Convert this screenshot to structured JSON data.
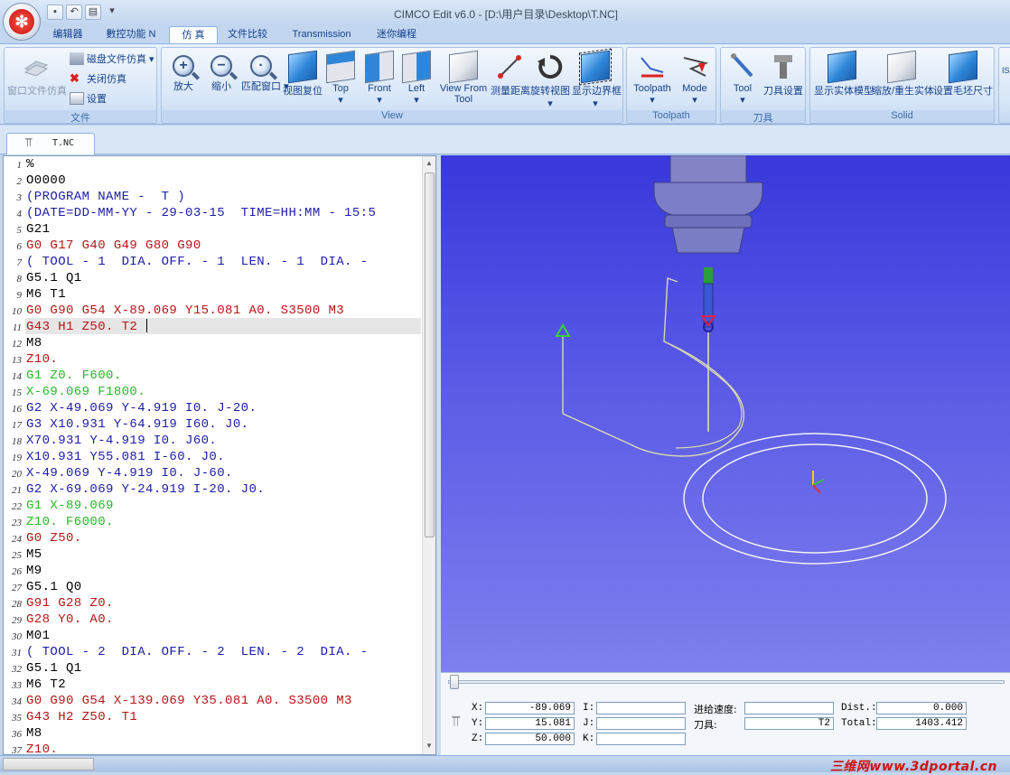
{
  "window": {
    "title": "CIMCO Edit v6.0 - [D:\\用户目录\\Desktop\\T.NC]"
  },
  "tabs": [
    "编辑器",
    "數控功能 N",
    "仿 真",
    "文件比较",
    "Transmission",
    "迷你编程"
  ],
  "active_tab": "仿 真",
  "ribbon": {
    "file_group": {
      "caption": "文件",
      "open_window": "窗口文件仿真",
      "disk_sim": "磁盘文件仿真",
      "close_sim": "关闭仿真",
      "settings": "设置"
    },
    "view_group": {
      "caption": "View",
      "buttons": [
        "放大",
        "缩小",
        "匹配窗口",
        "视图复位",
        "Top",
        "Front",
        "Left",
        "View From Tool",
        "测量距离",
        "旋转视图",
        "显示边界框"
      ]
    },
    "toolpath_group": {
      "caption": "Toolpath",
      "buttons": [
        "Toolpath",
        "Mode"
      ]
    },
    "tool_group": {
      "caption": "刀具",
      "buttons": [
        "Tool",
        "刀具设置"
      ]
    },
    "solid_group": {
      "caption": "Solid",
      "buttons": [
        "显示实体模型",
        "缩放/重生实体",
        "设置毛坯尺寸"
      ]
    },
    "extra_label": "IS"
  },
  "document_tab": "T.NC",
  "code_lines": [
    {
      "n": "1",
      "t": "%",
      "c": "#000000"
    },
    {
      "n": "2",
      "t": "O0000",
      "c": "#000000"
    },
    {
      "n": "3",
      "t": "(PROGRAM NAME -  T )",
      "c": "#1c1ca8"
    },
    {
      "n": "4",
      "t": "(DATE=DD-MM-YY - 29-03-15  TIME=HH:MM - 15:5",
      "c": "#1c1ca8"
    },
    {
      "n": "5",
      "t": "G21",
      "c": "#000000"
    },
    {
      "n": "6",
      "t": "G0 G17 G40 G49 G80 G90",
      "c": "#b81414"
    },
    {
      "n": "7",
      "t": "( TOOL - 1  DIA. OFF. - 1  LEN. - 1  DIA. -",
      "c": "#1c1ca8"
    },
    {
      "n": "8",
      "t": "G5.1 Q1",
      "c": "#000000"
    },
    {
      "n": "9",
      "t": "M6 T1",
      "c": "#000000"
    },
    {
      "n": "10",
      "t": "G0 G90 G54 X-89.069 Y15.081 A0. S3500 M3",
      "c": "#b81414"
    },
    {
      "n": "11",
      "t": "G43 H1 Z50. T2",
      "c": "#b81414"
    },
    {
      "n": "12",
      "t": "M8",
      "c": "#000000"
    },
    {
      "n": "13",
      "t": "Z10.",
      "c": "#b81414"
    },
    {
      "n": "14",
      "t": "G1 Z0. F600.",
      "c": "#27b827"
    },
    {
      "n": "15",
      "t": "X-69.069 F1800.",
      "c": "#27b827"
    },
    {
      "n": "16",
      "t": "G2 X-49.069 Y-4.919 I0. J-20.",
      "c": "#1c1ca8"
    },
    {
      "n": "17",
      "t": "G3 X10.931 Y-64.919 I60. J0.",
      "c": "#1c1ca8"
    },
    {
      "n": "18",
      "t": "X70.931 Y-4.919 I0. J60.",
      "c": "#1c1ca8"
    },
    {
      "n": "19",
      "t": "X10.931 Y55.081 I-60. J0.",
      "c": "#1c1ca8"
    },
    {
      "n": "20",
      "t": "X-49.069 Y-4.919 I0. J-60.",
      "c": "#1c1ca8"
    },
    {
      "n": "21",
      "t": "G2 X-69.069 Y-24.919 I-20. J0.",
      "c": "#1c1ca8"
    },
    {
      "n": "22",
      "t": "G1 X-89.069",
      "c": "#27b827"
    },
    {
      "n": "23",
      "t": "Z10. F6000.",
      "c": "#27b827"
    },
    {
      "n": "24",
      "t": "G0 Z50.",
      "c": "#b81414"
    },
    {
      "n": "25",
      "t": "M5",
      "c": "#000000"
    },
    {
      "n": "26",
      "t": "M9",
      "c": "#000000"
    },
    {
      "n": "27",
      "t": "G5.1 Q0",
      "c": "#000000"
    },
    {
      "n": "28",
      "t": "G91 G28 Z0.",
      "c": "#b81414"
    },
    {
      "n": "29",
      "t": "G28 Y0. A0.",
      "c": "#b81414"
    },
    {
      "n": "30",
      "t": "M01",
      "c": "#000000"
    },
    {
      "n": "31",
      "t": "( TOOL - 2  DIA. OFF. - 2  LEN. - 2  DIA. -",
      "c": "#1c1ca8"
    },
    {
      "n": "32",
      "t": "G5.1 Q1",
      "c": "#000000"
    },
    {
      "n": "33",
      "t": "M6 T2",
      "c": "#000000"
    },
    {
      "n": "34",
      "t": "G0 G90 G54 X-139.069 Y35.081 A0. S3500 M3",
      "c": "#b81414"
    },
    {
      "n": "35",
      "t": "G43 H2 Z50. T1",
      "c": "#b81414"
    },
    {
      "n": "36",
      "t": "M8",
      "c": "#000000"
    },
    {
      "n": "37",
      "t": "Z10.",
      "c": "#b81414"
    }
  ],
  "status": {
    "x_label": "X:",
    "x": "-89.069",
    "y_label": "Y:",
    "y": "15.081",
    "z_label": "Z:",
    "z": "50.000",
    "i_label": "I:",
    "i": "",
    "j_label": "J:",
    "j": "",
    "k_label": "K:",
    "k": "",
    "feed_label": "进给速度:",
    "feed": "",
    "tool_label": "刀具:",
    "tool": "T2",
    "dist_label": "Dist.:",
    "dist": "0.000",
    "total_label": "Total:",
    "total": "1403.412"
  },
  "watermark": "三维网www.3dportal.cn",
  "colors": {
    "viewport_top": "#3838dc",
    "viewport_bottom": "#7f7fee",
    "ribbon": "#c9dcf3",
    "accent_red": "#b81414",
    "accent_green": "#27b827",
    "accent_blue": "#1c1ca8"
  }
}
